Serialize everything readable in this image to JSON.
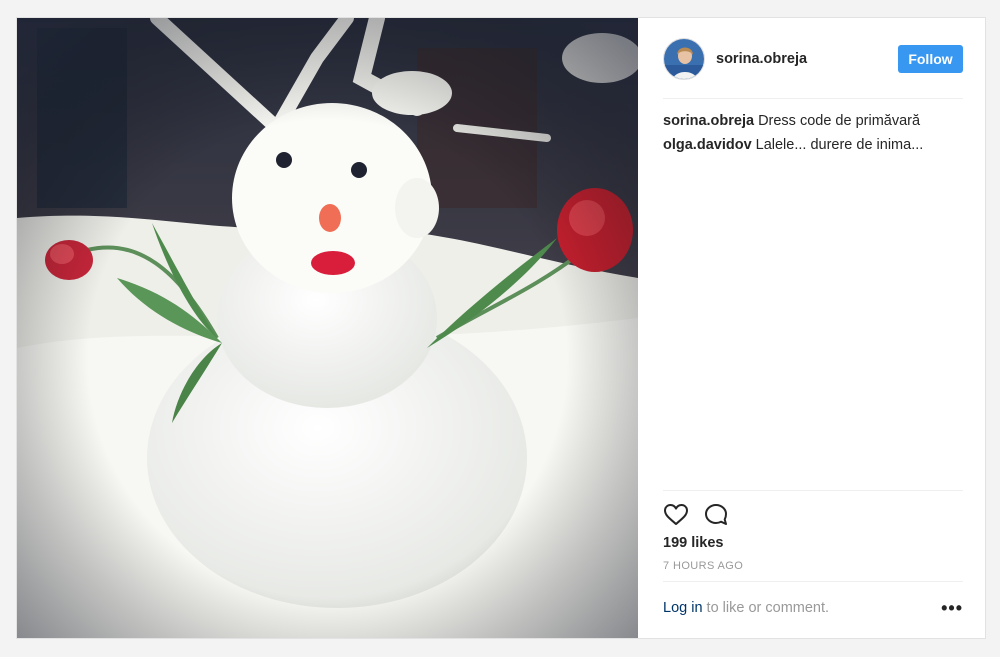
{
  "post": {
    "username": "sorina.obreja",
    "follow_label": "Follow",
    "comments": [
      {
        "user": "sorina.obreja",
        "text": "Dress code de primăvară"
      },
      {
        "user": "olga.davidov",
        "text": "Lalele... durere de inima..."
      }
    ],
    "likes": "199 likes",
    "time": "7 HOURS AGO",
    "login_link": "Log in",
    "login_rest": "to like or comment.",
    "more": "•••"
  },
  "colors": {
    "accent": "#3897f0",
    "link": "#003569",
    "muted": "#999999"
  },
  "icons": {
    "like": "heart-icon",
    "comment": "comment-bubble-icon",
    "more": "more-options-icon"
  }
}
